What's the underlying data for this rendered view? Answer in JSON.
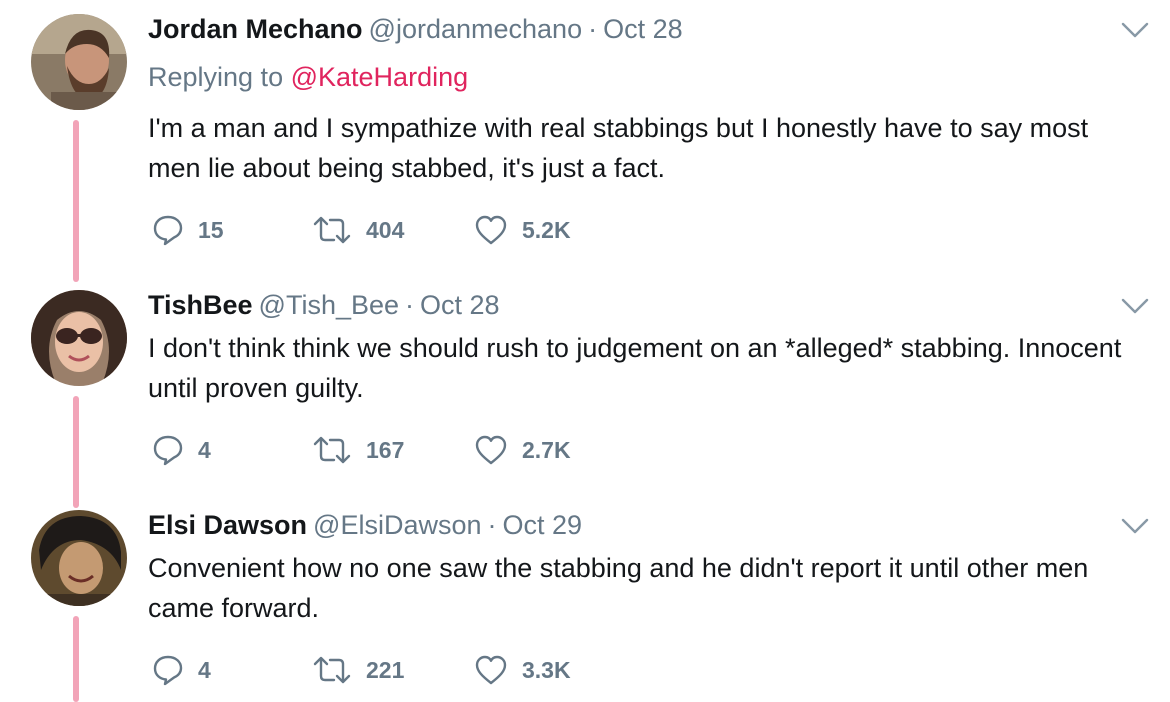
{
  "tweets": [
    {
      "name": "Jordan Mechano",
      "handle": "@jordanmechano",
      "separator": "·",
      "date": "Oct 28",
      "replying_prefix": "Replying to",
      "replying_to": "@KateHarding",
      "text": "I'm a man and I sympathize with real stabbings but I honestly have to say most men lie about being stabbed, it's just a fact.",
      "replies": "15",
      "retweets": "404",
      "likes": "5.2K"
    },
    {
      "name": "TishBee",
      "handle": "@Tish_Bee",
      "separator": "·",
      "date": "Oct 28",
      "text": "I don't think think we should rush to judgement on an *alleged* stabbing. Innocent until proven guilty.",
      "replies": "4",
      "retweets": "167",
      "likes": "2.7K"
    },
    {
      "name": "Elsi Dawson",
      "handle": "@ElsiDawson",
      "separator": "·",
      "date": "Oct 29",
      "text": "Convenient how no one saw the stabbing and he didn't report it until other men came forward.",
      "replies": "4",
      "retweets": "221",
      "likes": "3.3K"
    }
  ],
  "icons": {
    "reply": "reply-icon",
    "retweet": "retweet-icon",
    "like": "heart-icon",
    "more": "chevron-down-icon"
  },
  "colors": {
    "text": "#14171a",
    "secondary": "#657786",
    "mention": "#e0245e",
    "thread_line": "#f2a4b8"
  }
}
